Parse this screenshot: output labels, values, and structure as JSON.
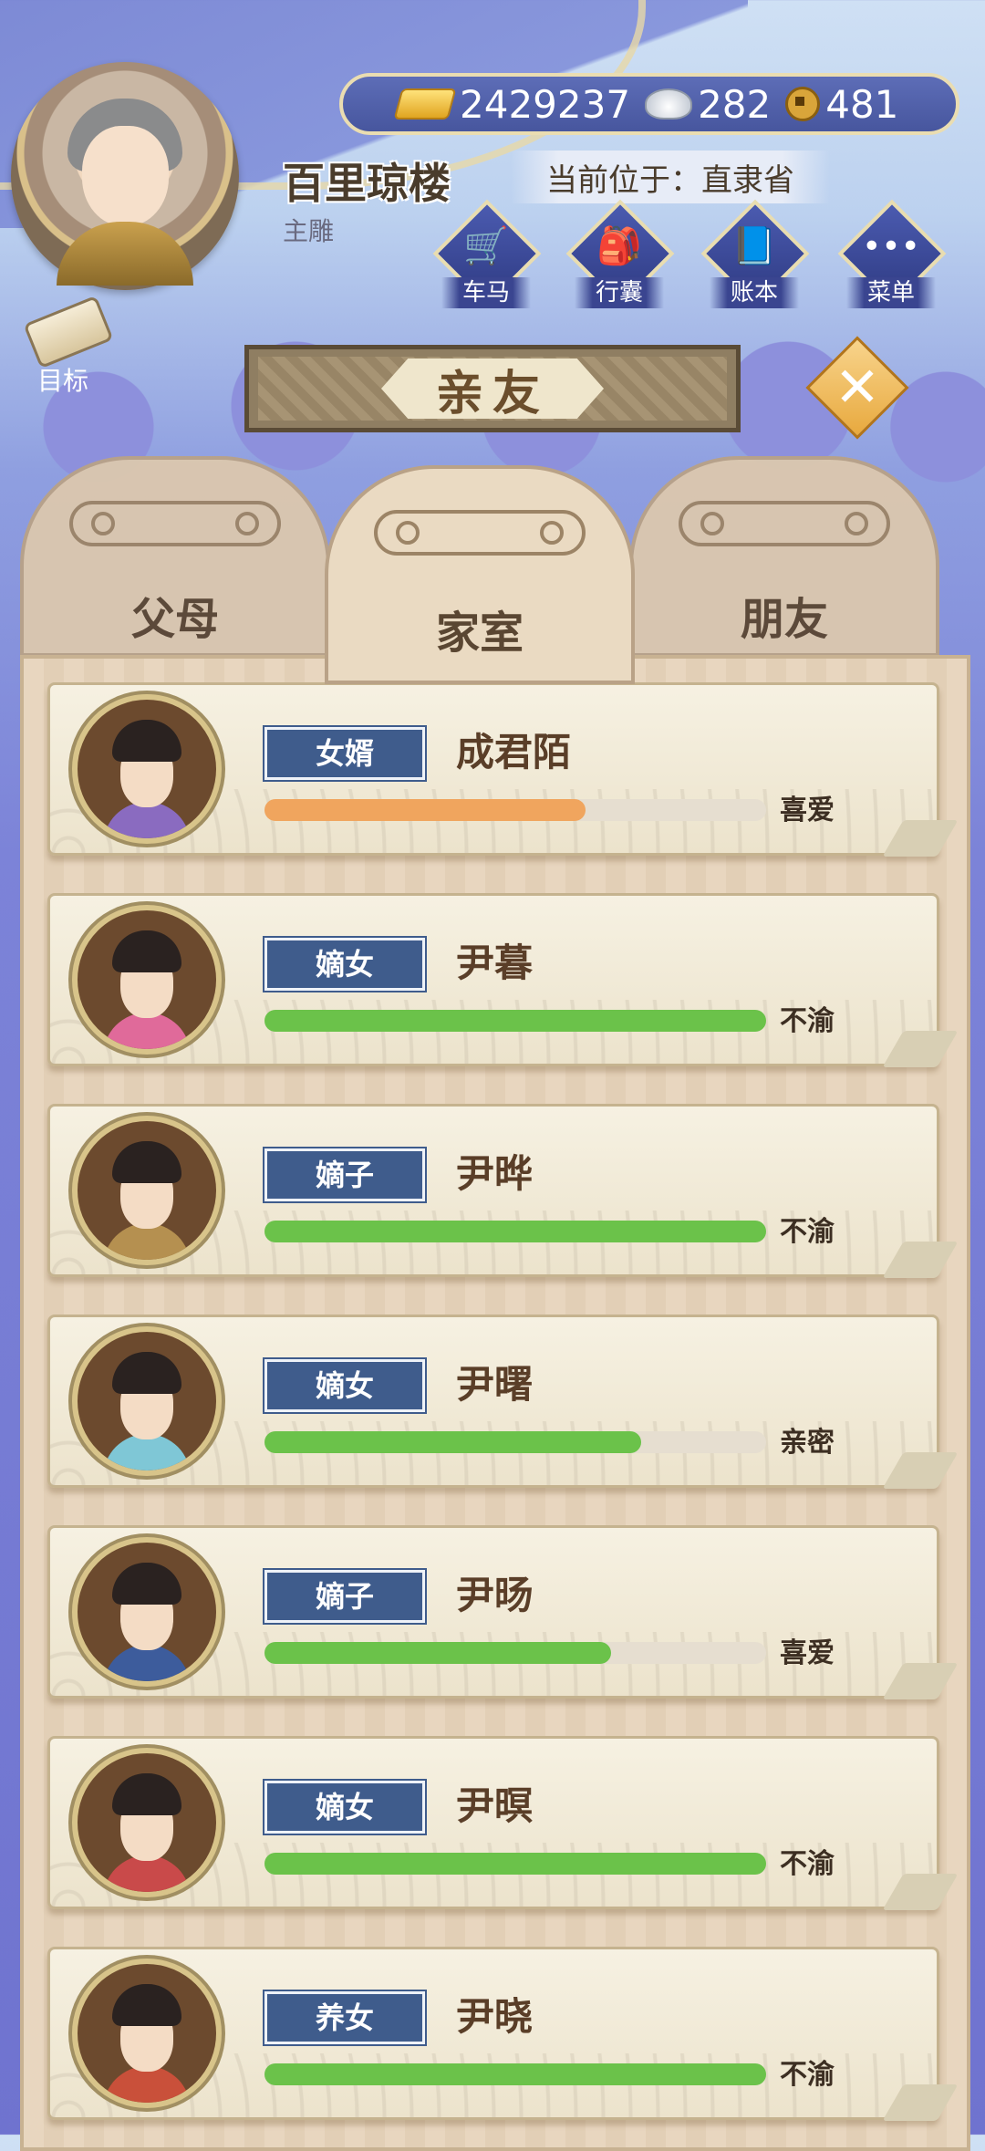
{
  "player": {
    "name": "百里琼楼",
    "title": "主雕",
    "location": "当前位于：直隶省"
  },
  "currency": {
    "gold": "2429237",
    "silver": "282",
    "coin": "481"
  },
  "top_buttons": [
    {
      "label": "车马",
      "icon": "carriage-icon",
      "glyph": "🛒"
    },
    {
      "label": "行囊",
      "icon": "bag-icon",
      "glyph": "🎒"
    },
    {
      "label": "账本",
      "icon": "ledger-icon",
      "glyph": "📘"
    },
    {
      "label": "菜单",
      "icon": "more-icon",
      "glyph": "•••"
    }
  ],
  "target_label": "目标",
  "page_title": "亲友",
  "tabs": [
    {
      "label": "父母"
    },
    {
      "label": "家室",
      "active": true
    },
    {
      "label": "朋友"
    }
  ],
  "colors": {
    "bar_orange": "#f0a55e",
    "bar_green": "#6bc24a",
    "badge_blue": "#3f5c8c"
  },
  "relatives": [
    {
      "relation": "女婿",
      "name": "成君陌",
      "affinity": "喜爱",
      "level": 0.64,
      "color": "#f0a55e",
      "robe": "#8a6bc0"
    },
    {
      "relation": "嫡女",
      "name": "尹暮",
      "affinity": "不渝",
      "level": 1.0,
      "color": "#6bc24a",
      "robe": "#e06a9a"
    },
    {
      "relation": "嫡子",
      "name": "尹晔",
      "affinity": "不渝",
      "level": 1.0,
      "color": "#6bc24a",
      "robe": "#b59050"
    },
    {
      "relation": "嫡女",
      "name": "尹曙",
      "affinity": "亲密",
      "level": 0.75,
      "color": "#6bc24a",
      "robe": "#7fc7d6"
    },
    {
      "relation": "嫡子",
      "name": "尹旸",
      "affinity": "喜爱",
      "level": 0.69,
      "color": "#6bc24a",
      "robe": "#3d5c9c"
    },
    {
      "relation": "嫡女",
      "name": "尹暝",
      "affinity": "不渝",
      "level": 1.0,
      "color": "#6bc24a",
      "robe": "#c94a4a"
    },
    {
      "relation": "养女",
      "name": "尹晓",
      "affinity": "不渝",
      "level": 1.0,
      "color": "#6bc24a",
      "robe": "#c9503a"
    }
  ]
}
